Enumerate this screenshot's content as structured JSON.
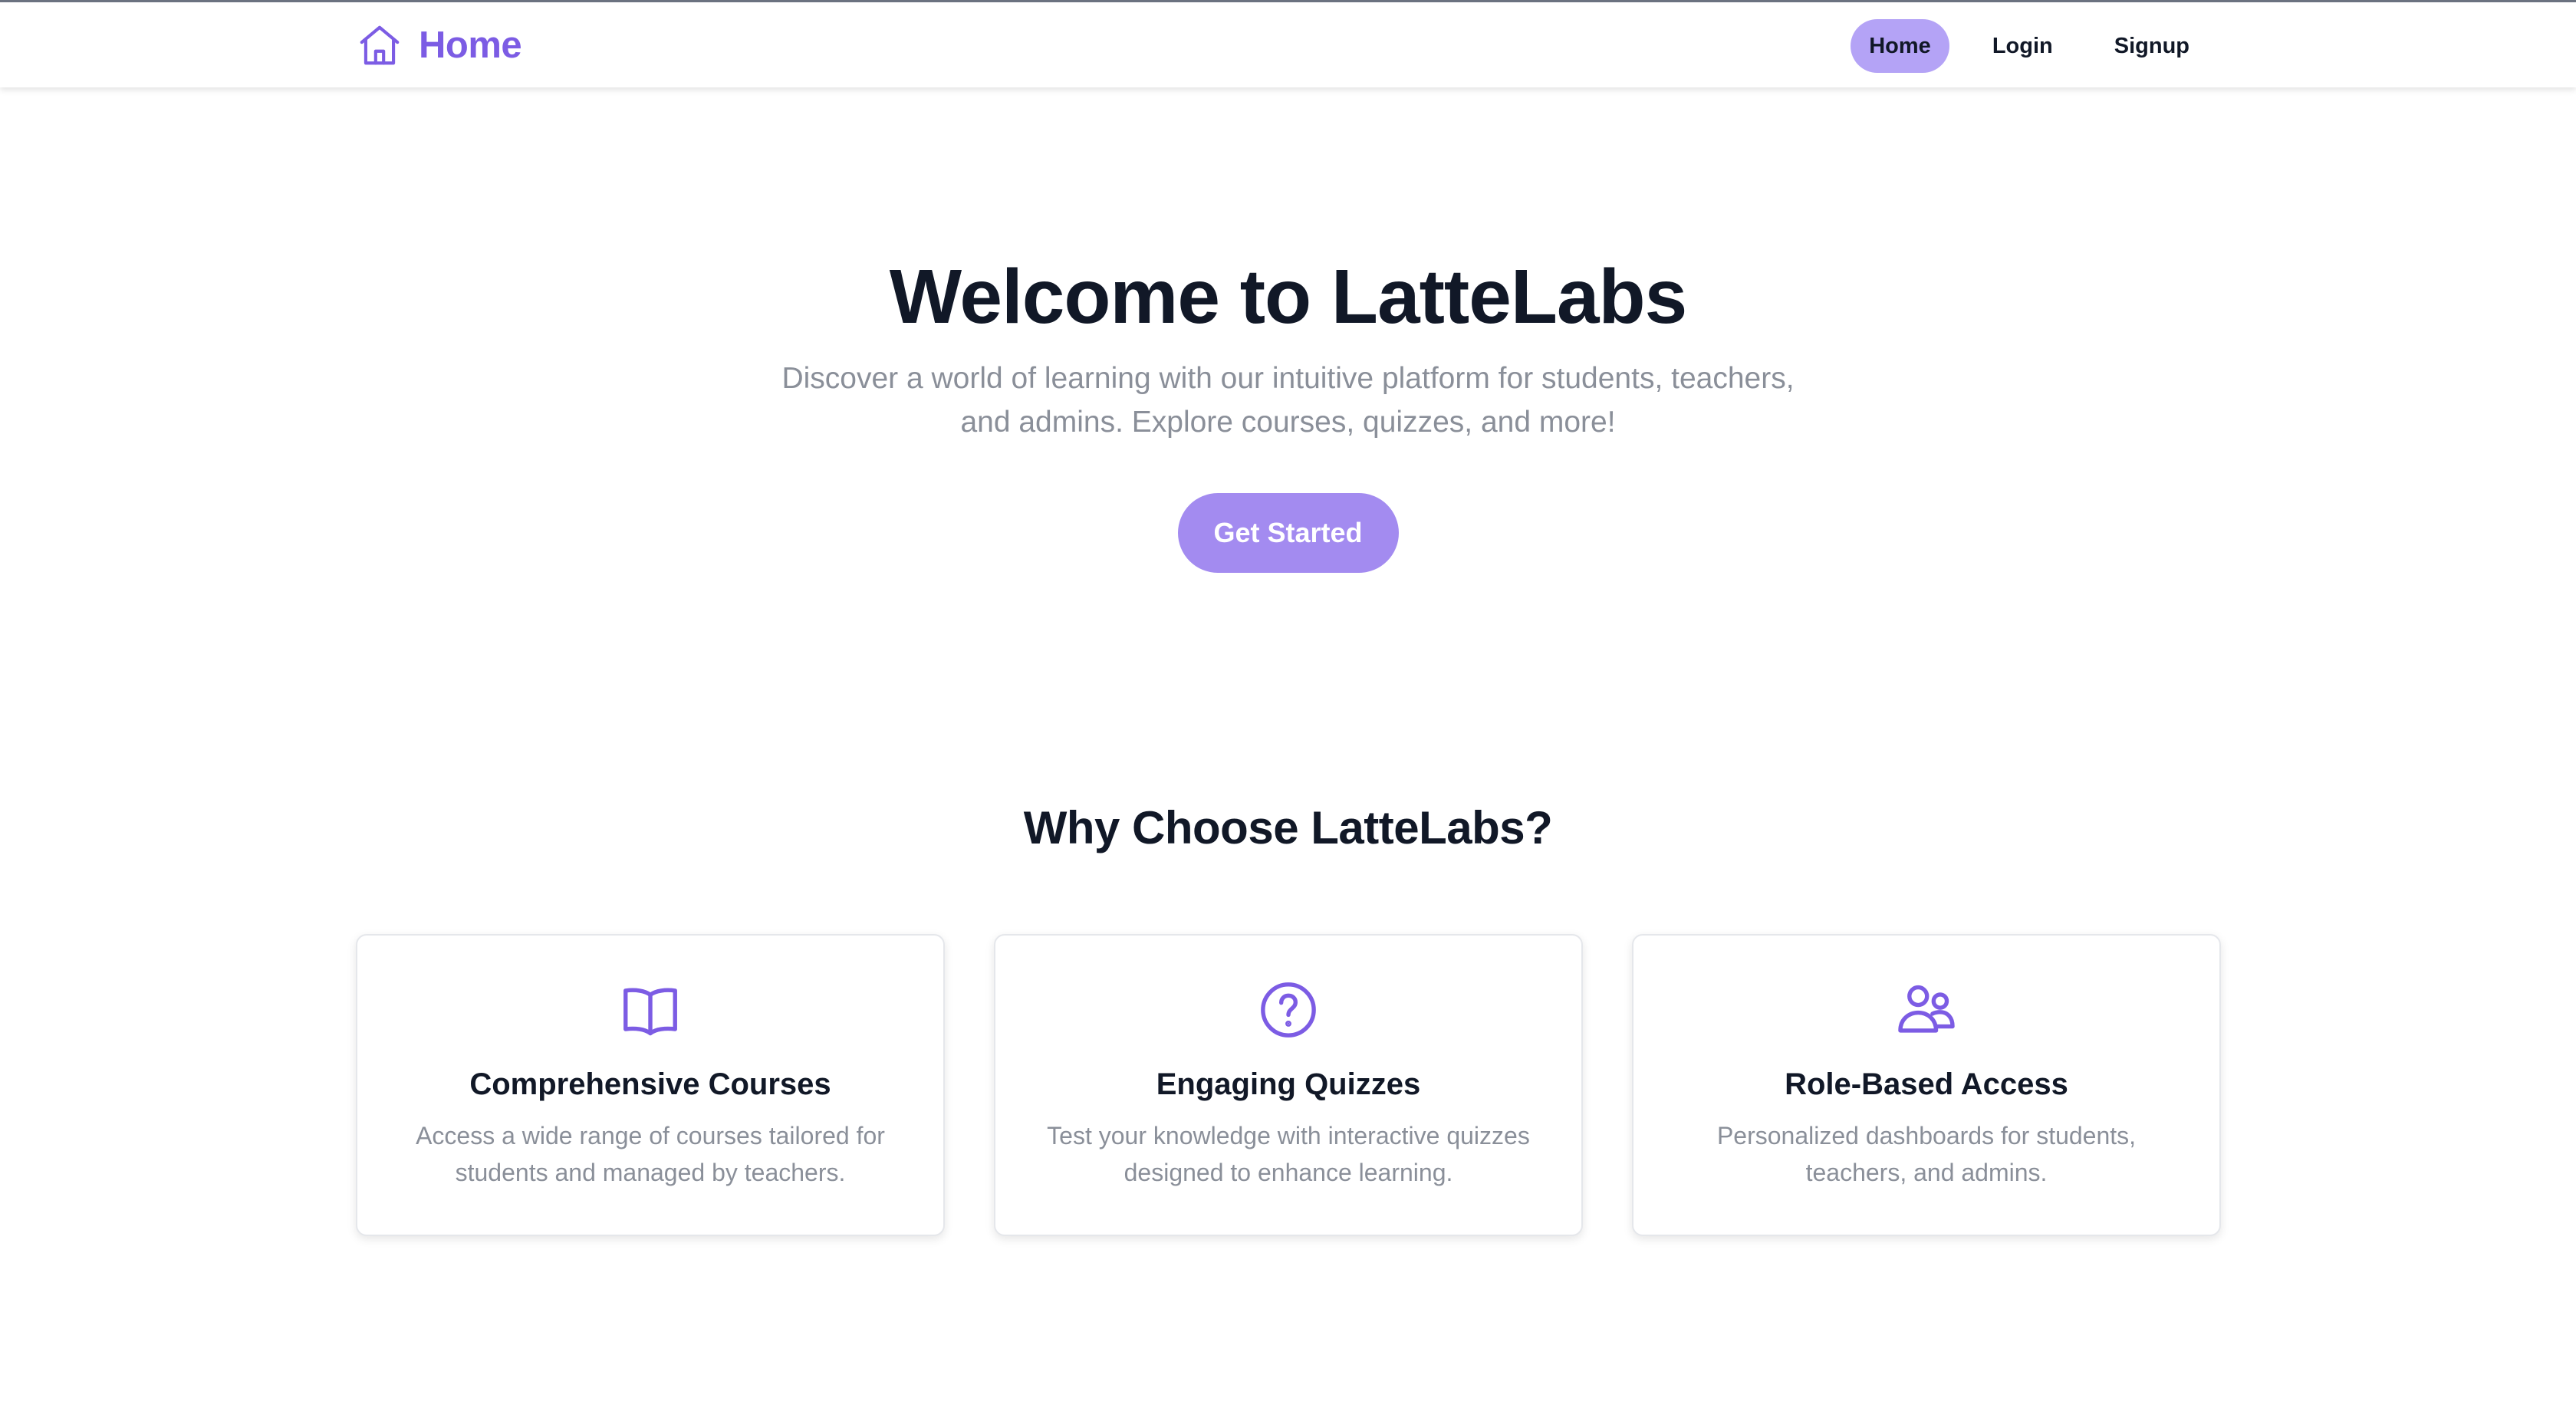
{
  "nav": {
    "brand_label": "Home",
    "brand_icon": "house-icon",
    "links": [
      {
        "label": "Home",
        "active": true
      },
      {
        "label": "Login",
        "active": false
      },
      {
        "label": "Signup",
        "active": false
      }
    ]
  },
  "hero": {
    "title": "Welcome to LatteLabs",
    "subtitle": "Discover a world of learning with our intuitive platform for students, teachers, and admins. Explore courses, quizzes, and more!",
    "cta_label": "Get Started"
  },
  "features": {
    "heading": "Why Choose LatteLabs?",
    "cards": [
      {
        "icon": "open-book-icon",
        "title": "Comprehensive Courses",
        "description": "Access a wide range of courses tailored for students and managed by teachers."
      },
      {
        "icon": "question-circle-icon",
        "title": "Engaging Quizzes",
        "description": "Test your knowledge with interactive quizzes designed to enhance learning."
      },
      {
        "icon": "users-icon",
        "title": "Role-Based Access",
        "description": "Personalized dashboards for students, teachers, and admins."
      }
    ]
  },
  "colors": {
    "accent": "#7c5ce4",
    "button": "#a38bf0",
    "active_nav": "#b4a3f6",
    "heading": "#111827",
    "muted_text": "#8a8f99"
  }
}
